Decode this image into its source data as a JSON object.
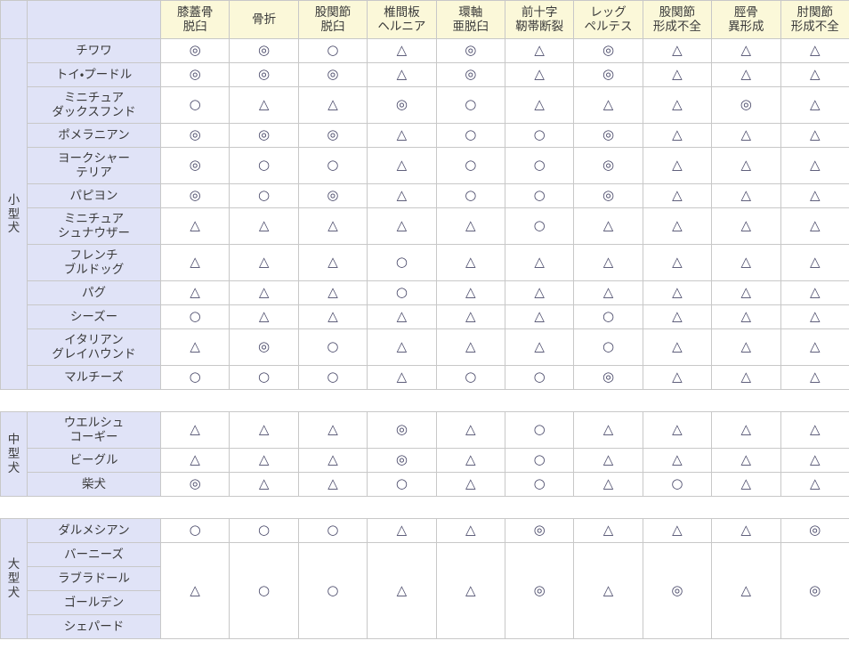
{
  "table": {
    "corner_label": "",
    "symbol_legend": {
      "double_circle": "◎",
      "circle": "○",
      "triangle": "△"
    },
    "colors": {
      "header_bg": "#FBF8D9",
      "label_bg": "#E0E3F7",
      "cell_bg": "#FFFFFF",
      "border": "#C8C8C8",
      "text": "#3A3A3A",
      "symbol": "#4A4A6A"
    },
    "columns": [
      {
        "id": "shitsugaikotsu_dakkyu",
        "lines": [
          "膝蓋骨",
          "脱臼"
        ]
      },
      {
        "id": "kossetsu",
        "lines": [
          "骨折"
        ]
      },
      {
        "id": "kokansetsu_dakkyu",
        "lines": [
          "股関節",
          "脱臼"
        ]
      },
      {
        "id": "tsuikanban_hernia",
        "lines": [
          "椎間板",
          "ヘルニア"
        ]
      },
      {
        "id": "kanjiku_adakkyu",
        "lines": [
          "環軸",
          "亜脱臼"
        ]
      },
      {
        "id": "zenjuji_jintai_danretsu",
        "lines": [
          "前十字",
          "靭帯断裂"
        ]
      },
      {
        "id": "legg_perthes",
        "lines": [
          "レッグ",
          "ペルテス"
        ]
      },
      {
        "id": "kokansetsu_keisei_fuzen",
        "lines": [
          "股関節",
          "形成不全"
        ]
      },
      {
        "id": "keikotsu_ikeisei",
        "lines": [
          "脛骨",
          "異形成"
        ]
      },
      {
        "id": "chukansetsu_keisei_fuzen",
        "lines": [
          "肘関節",
          "形成不全"
        ]
      }
    ],
    "groups": [
      {
        "id": "small",
        "label_chars": [
          "小",
          "型",
          "犬"
        ],
        "label": "小型犬",
        "rows": [
          {
            "breed_lines": [
              "チワワ"
            ],
            "breed": "チワワ",
            "values": [
              "◎",
              "◎",
              "○",
              "△",
              "◎",
              "△",
              "◎",
              "△",
              "△",
              "△"
            ]
          },
          {
            "breed_lines": [
              "トイ・プードル"
            ],
            "breed": "トイ・プードル",
            "values": [
              "◎",
              "◎",
              "◎",
              "△",
              "◎",
              "△",
              "◎",
              "△",
              "△",
              "△"
            ]
          },
          {
            "breed_lines": [
              "ミニチュア",
              "ダックスフンド"
            ],
            "breed": "ミニチュアダックスフンド",
            "values": [
              "○",
              "△",
              "△",
              "◎",
              "○",
              "△",
              "△",
              "△",
              "◎",
              "△"
            ]
          },
          {
            "breed_lines": [
              "ポメラニアン"
            ],
            "breed": "ポメラニアン",
            "values": [
              "◎",
              "◎",
              "◎",
              "△",
              "○",
              "○",
              "◎",
              "△",
              "△",
              "△"
            ]
          },
          {
            "breed_lines": [
              "ヨークシャー",
              "テリア"
            ],
            "breed": "ヨークシャーテリア",
            "values": [
              "◎",
              "○",
              "○",
              "△",
              "○",
              "○",
              "◎",
              "△",
              "△",
              "△"
            ]
          },
          {
            "breed_lines": [
              "パピヨン"
            ],
            "breed": "パピヨン",
            "values": [
              "◎",
              "○",
              "◎",
              "△",
              "○",
              "○",
              "◎",
              "△",
              "△",
              "△"
            ]
          },
          {
            "breed_lines": [
              "ミニチュア",
              "シュナウザー"
            ],
            "breed": "ミニチュアシュナウザー",
            "values": [
              "△",
              "△",
              "△",
              "△",
              "△",
              "○",
              "△",
              "△",
              "△",
              "△"
            ]
          },
          {
            "breed_lines": [
              "フレンチ",
              "ブルドッグ"
            ],
            "breed": "フレンチブルドッグ",
            "values": [
              "△",
              "△",
              "△",
              "○",
              "△",
              "△",
              "△",
              "△",
              "△",
              "△"
            ]
          },
          {
            "breed_lines": [
              "パグ"
            ],
            "breed": "パグ",
            "values": [
              "△",
              "△",
              "△",
              "○",
              "△",
              "△",
              "△",
              "△",
              "△",
              "△"
            ]
          },
          {
            "breed_lines": [
              "シーズー"
            ],
            "breed": "シーズー",
            "values": [
              "○",
              "△",
              "△",
              "△",
              "△",
              "△",
              "○",
              "△",
              "△",
              "△"
            ]
          },
          {
            "breed_lines": [
              "イタリアン",
              "グレイハウンド"
            ],
            "breed": "イタリアングレイハウンド",
            "values": [
              "△",
              "◎",
              "○",
              "△",
              "△",
              "△",
              "○",
              "△",
              "△",
              "△"
            ]
          },
          {
            "breed_lines": [
              "マルチーズ"
            ],
            "breed": "マルチーズ",
            "values": [
              "○",
              "○",
              "○",
              "△",
              "○",
              "○",
              "◎",
              "△",
              "△",
              "△"
            ]
          }
        ]
      },
      {
        "id": "medium",
        "label_chars": [
          "中",
          "型",
          "犬"
        ],
        "label": "中型犬",
        "rows": [
          {
            "breed_lines": [
              "ウエルシュ",
              "コーギー"
            ],
            "breed": "ウエルシュコーギー",
            "values": [
              "△",
              "△",
              "△",
              "◎",
              "△",
              "○",
              "△",
              "△",
              "△",
              "△"
            ]
          },
          {
            "breed_lines": [
              "ビーグル"
            ],
            "breed": "ビーグル",
            "values": [
              "△",
              "△",
              "△",
              "◎",
              "△",
              "○",
              "△",
              "△",
              "△",
              "△"
            ]
          },
          {
            "breed_lines": [
              "柴犬"
            ],
            "breed": "柴犬",
            "values": [
              "◎",
              "△",
              "△",
              "○",
              "△",
              "○",
              "△",
              "○",
              "△",
              "△"
            ]
          }
        ]
      },
      {
        "id": "large",
        "label_chars": [
          "大",
          "型",
          "犬"
        ],
        "label": "大型犬",
        "rows": [
          {
            "breed_lines": [
              "ダルメシアン"
            ],
            "breed": "ダルメシアン",
            "values": [
              "○",
              "○",
              "○",
              "△",
              "△",
              "◎",
              "△",
              "△",
              "△",
              "◎"
            ]
          }
        ],
        "merged_block": {
          "breed_lines": [
            "バーニーズ",
            "ラブラドール",
            "ゴールデン",
            "シェパード"
          ],
          "breeds": [
            "バーニーズ",
            "ラブラドール",
            "ゴールデン",
            "シェパード"
          ],
          "values": [
            "△",
            "○",
            "○",
            "△",
            "△",
            "◎",
            "△",
            "◎",
            "△",
            "◎"
          ]
        }
      }
    ]
  }
}
